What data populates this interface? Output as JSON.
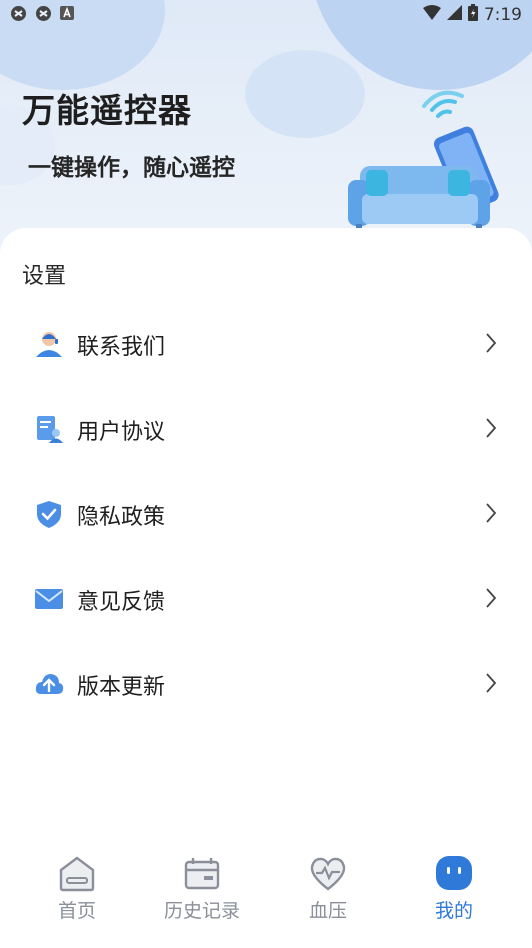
{
  "status": {
    "time": "7:19"
  },
  "header": {
    "title": "万能遥控器",
    "subtitle": "一键操作，随心遥控"
  },
  "settings": {
    "title": "设置",
    "items": [
      {
        "label": "联系我们",
        "icon": "support-agent-icon"
      },
      {
        "label": "用户协议",
        "icon": "agreement-document-icon"
      },
      {
        "label": "隐私政策",
        "icon": "shield-check-icon"
      },
      {
        "label": "意见反馈",
        "icon": "envelope-icon"
      },
      {
        "label": "版本更新",
        "icon": "cloud-upload-icon"
      }
    ]
  },
  "tabs": [
    {
      "label": "首页",
      "icon": "home-icon",
      "active": false
    },
    {
      "label": "历史记录",
      "icon": "history-card-icon",
      "active": false
    },
    {
      "label": "血压",
      "icon": "heart-pulse-icon",
      "active": false
    },
    {
      "label": "我的",
      "icon": "profile-face-icon",
      "active": true
    }
  ],
  "colors": {
    "accent": "#2f7ad8",
    "icon_blue": "#4a90e2",
    "text": "#1f1f1f",
    "inactive": "#8a8f99"
  }
}
